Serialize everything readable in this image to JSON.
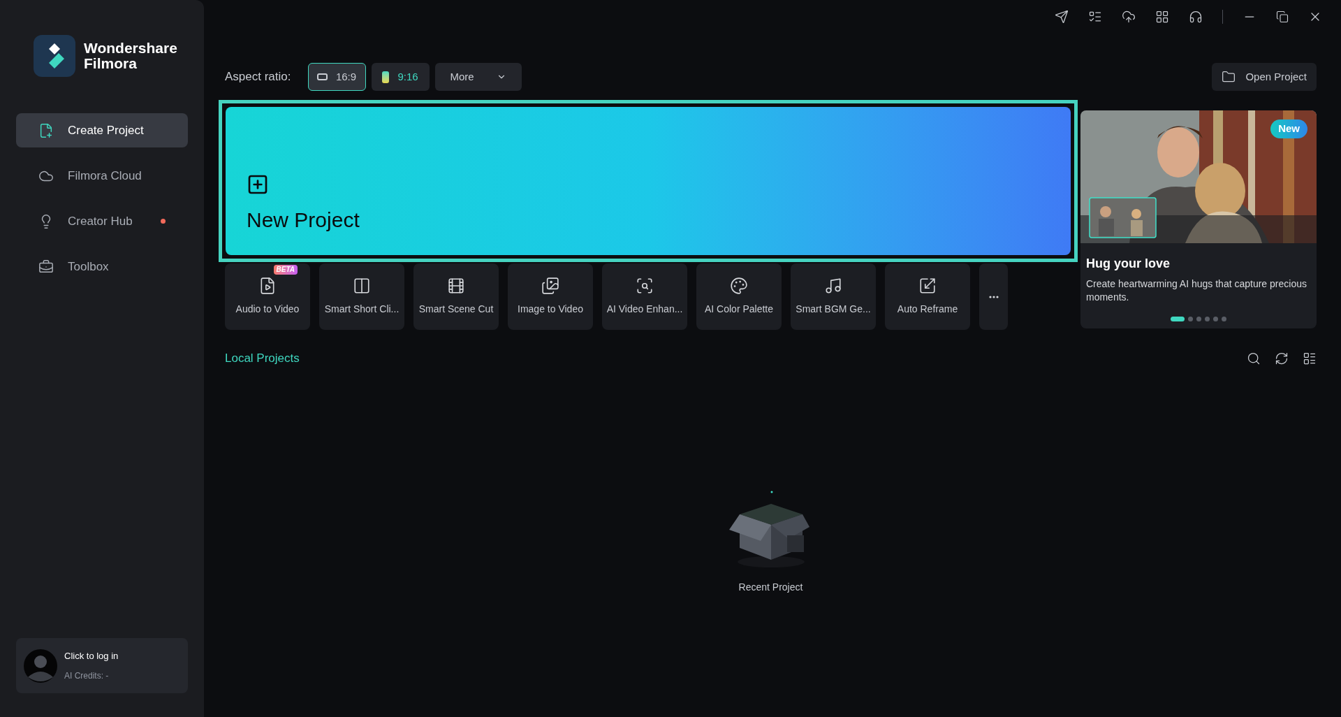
{
  "app": {
    "name_line1": "Wondershare",
    "name_line2": "Filmora"
  },
  "sidebar": {
    "items": [
      {
        "label": "Create Project",
        "selected": true,
        "dot": false
      },
      {
        "label": "Filmora Cloud",
        "selected": false,
        "dot": false
      },
      {
        "label": "Creator Hub",
        "selected": false,
        "dot": true
      },
      {
        "label": "Toolbox",
        "selected": false,
        "dot": false
      }
    ]
  },
  "account": {
    "login": "Click to log in",
    "credits": "AI Credits: -"
  },
  "aspect_ratio": {
    "label": "Aspect ratio:",
    "options": [
      {
        "label": "16:9",
        "selected": true
      },
      {
        "label": "9:16",
        "selected": false
      }
    ],
    "more": "More"
  },
  "open_project": "Open Project",
  "new_project": "New Project",
  "tools": [
    {
      "label": "Audio to Video",
      "badge": "BETA"
    },
    {
      "label": "Smart Short Cli..."
    },
    {
      "label": "Smart Scene Cut"
    },
    {
      "label": "Image to Video"
    },
    {
      "label": "AI Video Enhan..."
    },
    {
      "label": "AI Color Palette"
    },
    {
      "label": "Smart BGM Ge..."
    },
    {
      "label": "Auto Reframe"
    }
  ],
  "promo": {
    "badge": "New",
    "title": "Hug your love",
    "description": "Create heartwarming AI hugs that capture precious moments.",
    "slides": [
      {
        "selected": true
      },
      {
        "selected": false
      },
      {
        "selected": false
      },
      {
        "selected": false
      },
      {
        "selected": false
      },
      {
        "selected": false
      }
    ]
  },
  "local_projects": {
    "title": "Local Projects",
    "empty_label": "Recent Project"
  }
}
